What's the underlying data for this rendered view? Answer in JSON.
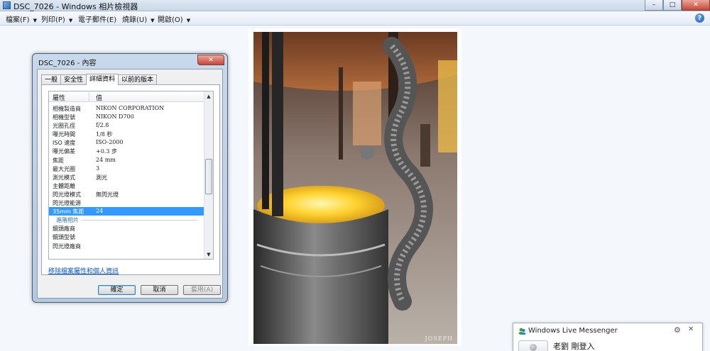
{
  "window": {
    "title": "DSC_7026 - Windows 相片檢視器",
    "minimize": "–",
    "maximize": "□",
    "close": "✕"
  },
  "menu": {
    "items": [
      {
        "label": "檔案(F)"
      },
      {
        "label": "列印(P)"
      },
      {
        "label": "電子郵件(E)"
      },
      {
        "label": "燒錄(U)"
      },
      {
        "label": "開啟(O)"
      }
    ],
    "help": "?"
  },
  "photo": {
    "watermark": "JOSEPH"
  },
  "dialog": {
    "title": "DSC_7026 - 內容",
    "close": "✕",
    "tabs": [
      {
        "label": "一般"
      },
      {
        "label": "安全性"
      },
      {
        "label": "詳細資料"
      },
      {
        "label": "以前的版本"
      }
    ],
    "active_tab": "詳細資料",
    "columns": {
      "property": "屬性",
      "value": "值"
    },
    "rows": [
      {
        "k": "相機製造商",
        "v": "NIKON CORPORATION"
      },
      {
        "k": "相機型號",
        "v": "NIKON D700"
      },
      {
        "k": "光圈孔徑",
        "v": "f/2.8"
      },
      {
        "k": "曝光時間",
        "v": "1/8 秒"
      },
      {
        "k": "ISO 速度",
        "v": "ISO-2000"
      },
      {
        "k": "曝光偏差",
        "v": "+0.3 步"
      },
      {
        "k": "焦距",
        "v": "24 mm"
      },
      {
        "k": "最大光圈",
        "v": "3"
      },
      {
        "k": "測光模式",
        "v": "測光"
      },
      {
        "k": "主體距離",
        "v": ""
      },
      {
        "k": "閃光燈模式",
        "v": "無閃光燈"
      },
      {
        "k": "閃光燈能源",
        "v": ""
      },
      {
        "k": "35mm 焦距",
        "v": "24"
      },
      {
        "k": "進階相片",
        "v": ""
      },
      {
        "k": "鏡頭廠商",
        "v": ""
      },
      {
        "k": "鏡頭型號",
        "v": ""
      },
      {
        "k": "閃光燈廠商",
        "v": ""
      }
    ],
    "selected_row": "35mm 焦距",
    "group_row": "進階相片",
    "remove_link": "移除檔案屬性和個人資訊",
    "buttons": {
      "ok": "確定",
      "cancel": "取消",
      "apply": "套用(A)"
    }
  },
  "messenger": {
    "title": "Windows Live Messenger",
    "gear": "⚙",
    "close": "✕",
    "message": "老劉 剛登入"
  }
}
